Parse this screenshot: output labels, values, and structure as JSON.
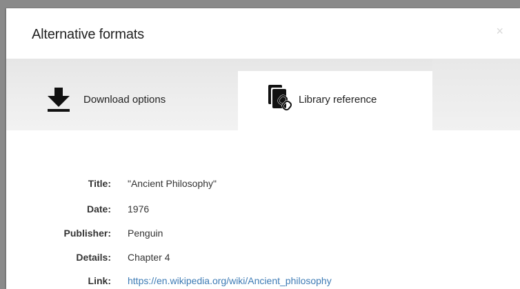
{
  "dialog": {
    "title": "Alternative formats",
    "close_glyph": "×"
  },
  "tabs": [
    {
      "label": "Download options",
      "icon": "download-icon",
      "selected": false
    },
    {
      "label": "Library reference",
      "icon": "library-link-icon",
      "selected": true
    }
  ],
  "reference": {
    "rows": [
      {
        "label": "Title:",
        "value": "\"Ancient Philosophy\""
      },
      {
        "label": "Date:",
        "value": "1976"
      },
      {
        "label": "Publisher:",
        "value": "Penguin"
      },
      {
        "label": "Details:",
        "value": "Chapter 4"
      },
      {
        "label": "Link:",
        "value": "https://en.wikipedia.org/wiki/Ancient_philosophy"
      }
    ]
  },
  "colors": {
    "link": "#3d7bb5",
    "tab_bar": "#ececec",
    "text": "#222222"
  }
}
